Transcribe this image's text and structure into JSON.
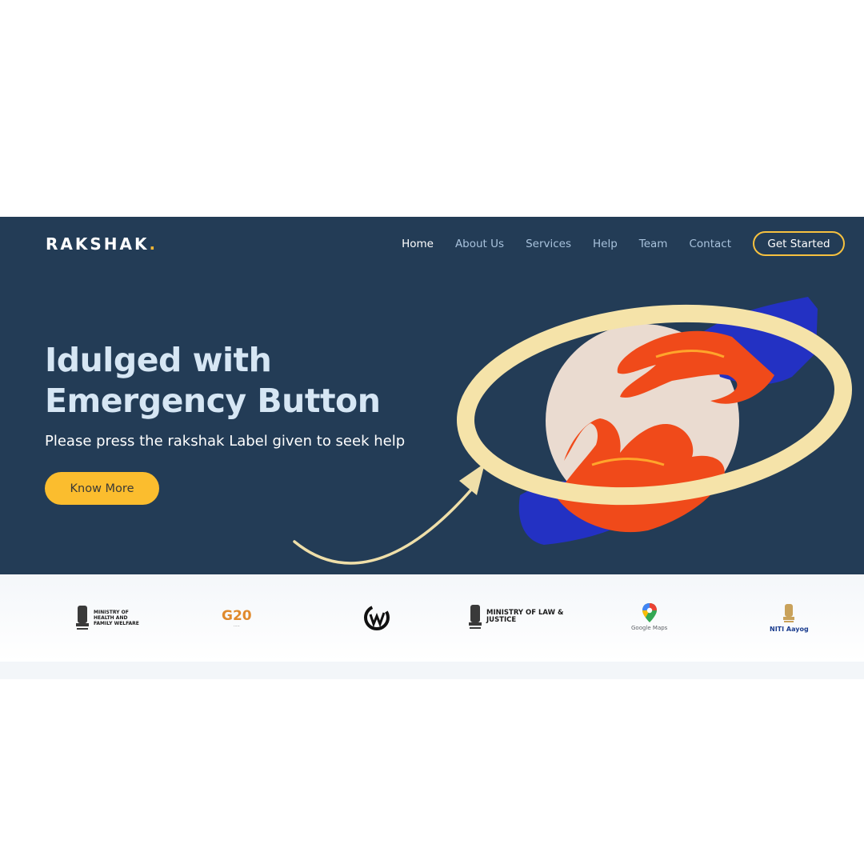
{
  "brand": {
    "name": "RAKSHAK",
    "dot": "."
  },
  "nav": {
    "items": [
      {
        "label": "Home",
        "active": true
      },
      {
        "label": "About Us"
      },
      {
        "label": "Services"
      },
      {
        "label": "Help"
      },
      {
        "label": "Team"
      },
      {
        "label": "Contact"
      }
    ],
    "cta": "Get Started"
  },
  "hero": {
    "headline_line1": "Idulged with",
    "headline_line2": "Emergency Button",
    "subheadline": "Please press the rakshak Label given to seek help",
    "button": "Know More"
  },
  "partners": {
    "health": {
      "line1": "MINISTRY OF",
      "line2": "HEALTH AND",
      "line3": "FAMILY WELFARE"
    },
    "g20": {
      "text": "G20"
    },
    "law": {
      "line1": "MINISTRY OF LAW &",
      "line2": "JUSTICE"
    },
    "gmaps": {
      "label": "Google Maps"
    },
    "niti": {
      "label": "NITI Aayog"
    }
  },
  "colors": {
    "hero_bg": "#233c56",
    "accent_yellow": "#fbbd2e",
    "ring": "#f5e3a9",
    "headline": "#d6e6f4"
  }
}
